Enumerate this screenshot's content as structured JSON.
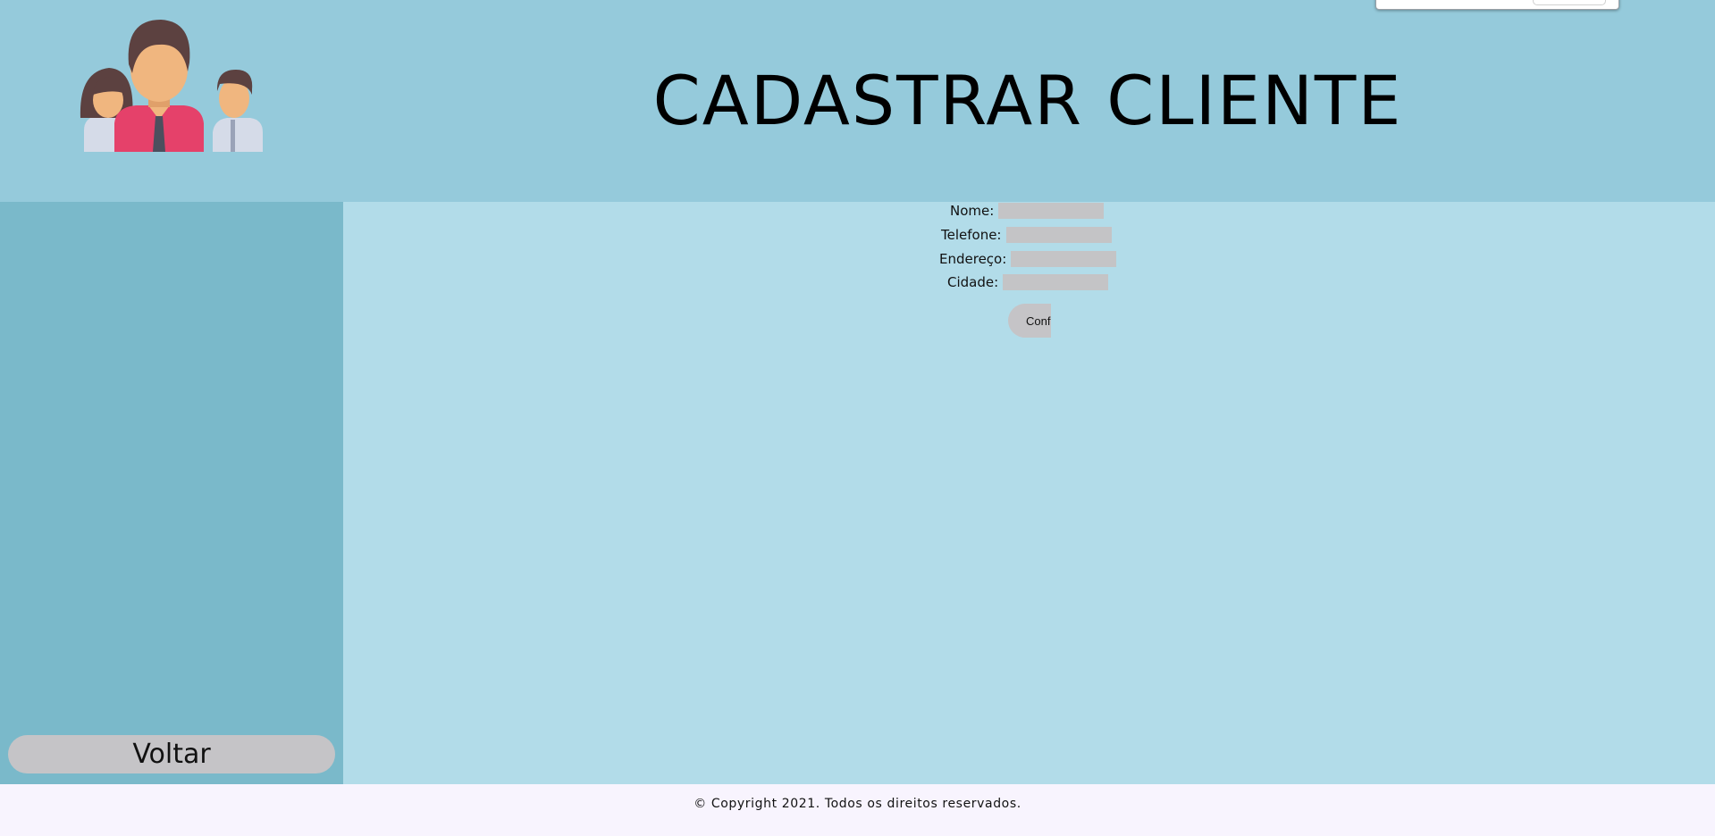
{
  "header": {
    "title": "CADASTRAR CLIENTE",
    "logo_icon": "family-people-icon"
  },
  "sidebar": {
    "back_label": "Voltar"
  },
  "form": {
    "fields": [
      {
        "label": "Nome:",
        "value": ""
      },
      {
        "label": "Telefone:",
        "value": ""
      },
      {
        "label": "Endereço:",
        "value": ""
      },
      {
        "label": "Cidade:",
        "value": ""
      }
    ],
    "confirm_label": "Conf"
  },
  "footer": {
    "copyright": "© Copyright 2021. Todos os direitos reservados."
  },
  "colors": {
    "header_bg": "#95cadb",
    "sidebar_bg": "#7ab9ca",
    "main_bg": "#b2dce9",
    "footer_bg": "#f8f4fe",
    "control_gray": "#c4c4c6"
  }
}
